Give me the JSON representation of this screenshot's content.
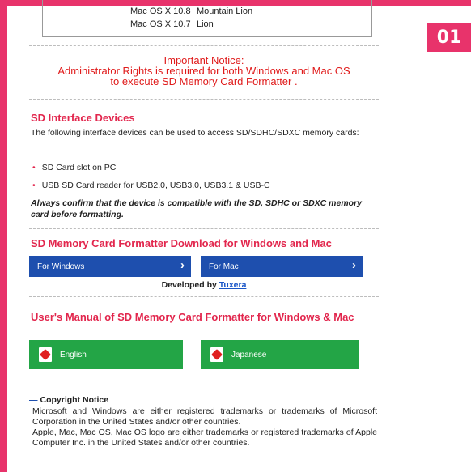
{
  "step_badge": "01",
  "os_table": {
    "rows": [
      {
        "version": "Mac OS X 10.8",
        "name": "Mountain Lion"
      },
      {
        "version": "Mac OS X 10.7",
        "name": "Lion"
      }
    ]
  },
  "notice": {
    "title": "Important Notice:",
    "line1": "Administrator Rights is required for both Windows and Mac OS",
    "line2": "to execute SD Memory Card Formatter ."
  },
  "interface": {
    "heading": "SD Interface Devices",
    "intro": "The following interface devices can be used to access SD/SDHC/SDXC memory cards:",
    "bullets": [
      "SD Card slot on PC",
      "USB SD Card reader for USB2.0, USB3.0, USB3.1 & USB-C"
    ],
    "note": "Always confirm that the device is compatible with the SD, SDHC or SDXC memory card before formatting."
  },
  "download": {
    "heading": "SD Memory Card Formatter Download for Windows and Mac",
    "windows_label": "For Windows",
    "mac_label": "For Mac",
    "developed_prefix": "Developed by",
    "developer_link": "Tuxera"
  },
  "manual": {
    "heading": "User's Manual of SD Memory Card Formatter for Windows & Mac",
    "english_label": "English",
    "japanese_label": "Japanese"
  },
  "copyright": {
    "title": "Copyright Notice",
    "para1": "Microsoft and Windows are either registered trademarks or trademarks of Microsoft Corporation in the United States and/or other countries.",
    "para2": "Apple, Mac, Mac OS, Mac OS logo are either trademarks or registered trademarks of Apple Computer Inc. in the United States and/or other countries."
  },
  "colors": {
    "accent": "#e8336b",
    "heading_red": "#e2264d",
    "notice_red": "#e01b1b",
    "button_blue": "#1e4fae",
    "button_green": "#23a546",
    "link_blue": "#1a56c8"
  },
  "icons": {
    "chevron": "chevron-right-icon",
    "pdf": "pdf-icon",
    "bullet": "bullet-dot-icon"
  }
}
